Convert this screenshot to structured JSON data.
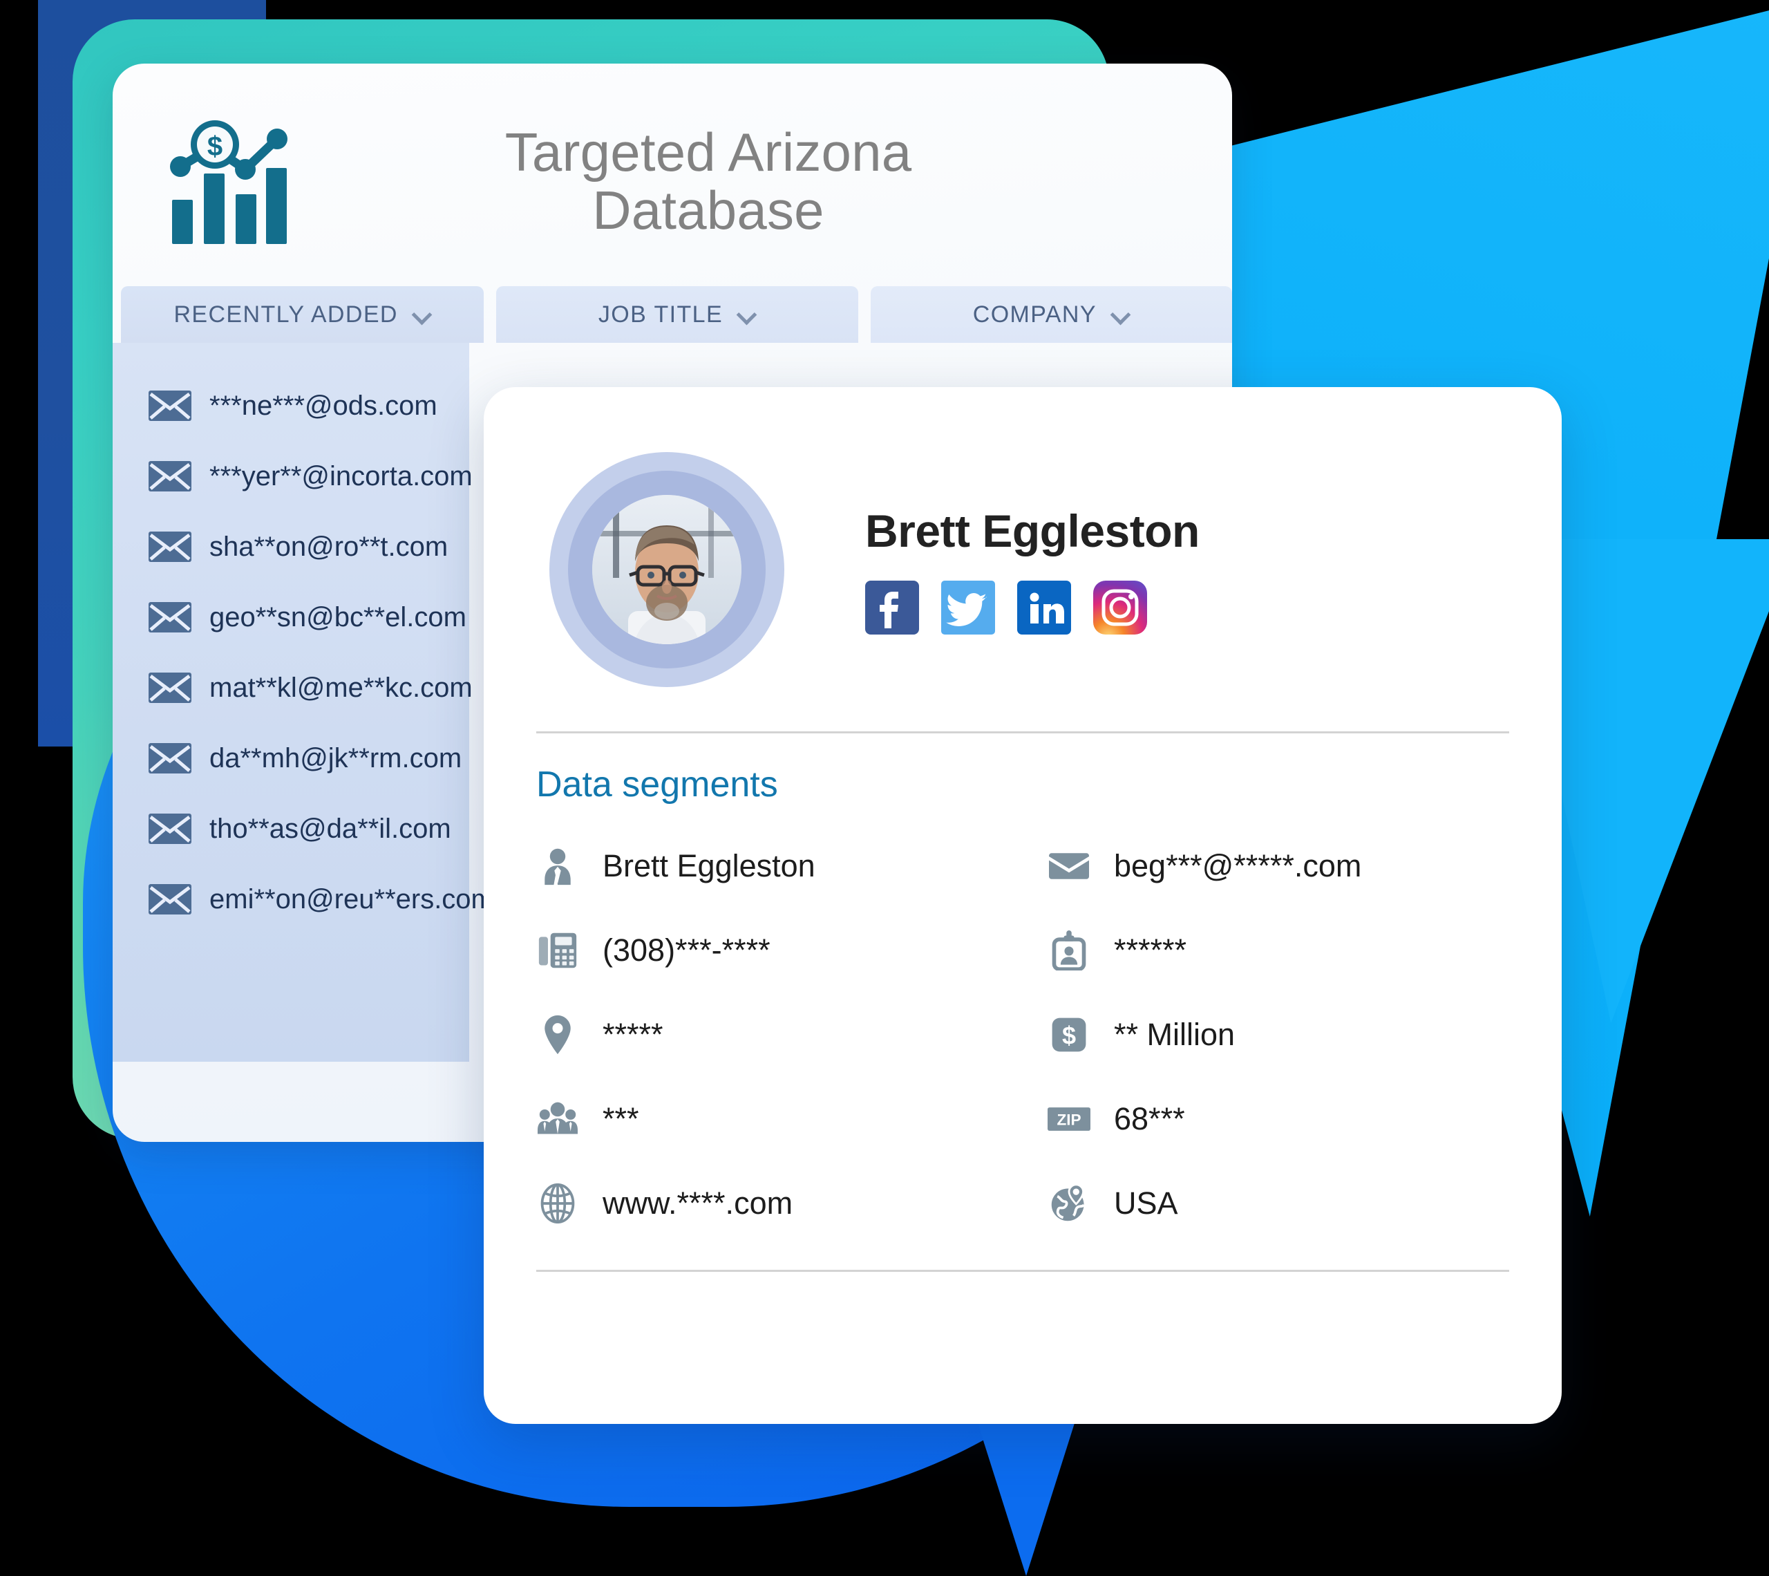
{
  "database_card": {
    "logo_icon": "bar-chart-dollar-icon",
    "title": "Targeted Arizona\nDatabase",
    "title_line1": "Targeted Arizona",
    "title_line2": "Database",
    "tabs": [
      {
        "label": "RECENTLY ADDED",
        "chevron": "chevron-down-icon"
      },
      {
        "label": "JOB TITLE",
        "chevron": "chevron-down-icon"
      },
      {
        "label": "COMPANY",
        "chevron": "chevron-down-icon"
      }
    ],
    "emails": [
      "***ne***@ods.com",
      "***yer**@incorta.com",
      "sha**on@ro**t.com",
      "geo**sn@bc**el.com",
      "mat**kl@me**kc.com",
      "da**mh@jk**rm.com",
      "tho**as@da**il.com",
      "emi**on@reu**ers.com"
    ]
  },
  "profile_card": {
    "avatar": "profile-photo-man-glasses",
    "name": "Brett Eggleston",
    "socials": [
      {
        "name": "facebook-icon",
        "color": "#3b5998"
      },
      {
        "name": "twitter-icon",
        "color": "#55acee"
      },
      {
        "name": "linkedin-icon",
        "color": "#0a66c2"
      },
      {
        "name": "instagram-icon",
        "color": "#e1306c"
      }
    ],
    "segments_heading": "Data segments",
    "segments_left": [
      {
        "icon": "person-tie-icon",
        "value": "Brett Eggleston"
      },
      {
        "icon": "fax-phone-icon",
        "value": "(308)***-****"
      },
      {
        "icon": "map-pin-icon",
        "value": "*****"
      },
      {
        "icon": "people-group-icon",
        "value": "***"
      },
      {
        "icon": "globe-grid-icon",
        "value": "www.****.com"
      }
    ],
    "segments_right": [
      {
        "icon": "envelope-icon",
        "value": "beg***@*****.com"
      },
      {
        "icon": "id-badge-icon",
        "value": "******"
      },
      {
        "icon": "dollar-square-icon",
        "value": "** Million"
      },
      {
        "icon": "zip-icon",
        "value": "68***"
      },
      {
        "icon": "globe-pin-icon",
        "value": "USA"
      }
    ]
  },
  "colors": {
    "teal_card": "#3fd0c0",
    "blue_blob": "#0f74f0",
    "cyan_shape": "#12b4fb",
    "navy_slab": "#1d4f9e",
    "logo_teal": "#136e8c",
    "heading_blue": "#1277ad",
    "tab_text": "#4b6184",
    "email_text": "#1e3356",
    "icon_gray": "#7d909d"
  }
}
